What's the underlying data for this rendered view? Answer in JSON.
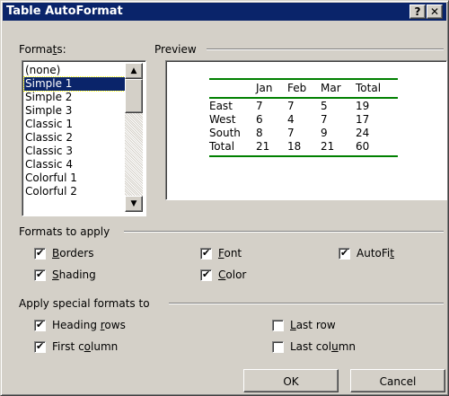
{
  "window": {
    "title": "Table AutoFormat",
    "help_symbol": "?",
    "close_symbol": "✕"
  },
  "formats": {
    "label_pre": "Forma",
    "label_key": "t",
    "label_post": "s:",
    "items": [
      "(none)",
      "Simple 1",
      "Simple 2",
      "Simple 3",
      "Classic 1",
      "Classic 2",
      "Classic 3",
      "Classic 4",
      "Colorful 1",
      "Colorful 2"
    ],
    "selected": "Simple 1"
  },
  "preview": {
    "label": "Preview",
    "line_color": "#008000",
    "header": [
      "",
      "Jan",
      "Feb",
      "Mar",
      "Total"
    ],
    "rows": [
      [
        "East",
        "7",
        "7",
        "5",
        "19"
      ],
      [
        "West",
        "6",
        "4",
        "7",
        "17"
      ],
      [
        "South",
        "8",
        "7",
        "9",
        "24"
      ],
      [
        "Total",
        "21",
        "18",
        "21",
        "60"
      ]
    ]
  },
  "formats_to_apply": {
    "label": "Formats to apply",
    "borders": {
      "key": "B",
      "rest": "orders",
      "checked": true
    },
    "shading": {
      "key": "S",
      "rest": "hading",
      "checked": true
    },
    "font": {
      "key": "F",
      "rest": "ont",
      "checked": true
    },
    "color": {
      "key": "C",
      "rest": "olor",
      "checked": true
    },
    "autofit": {
      "pre": "AutoFi",
      "key": "t",
      "rest": "",
      "checked": true
    }
  },
  "special_formats": {
    "label": "Apply special formats to",
    "heading_rows": {
      "pre": "Heading ",
      "key": "r",
      "rest": "ows",
      "checked": true
    },
    "first_column": {
      "pre": "First c",
      "key": "o",
      "rest": "lumn",
      "checked": true
    },
    "last_row": {
      "pre": "",
      "key": "L",
      "rest": "ast row",
      "checked": false
    },
    "last_column": {
      "pre": "Last col",
      "key": "u",
      "rest": "mn",
      "checked": false
    }
  },
  "buttons": {
    "ok": "OK",
    "cancel": "Cancel"
  },
  "check_glyph": "✔",
  "arrows": {
    "up": "▲",
    "down": "▼"
  }
}
